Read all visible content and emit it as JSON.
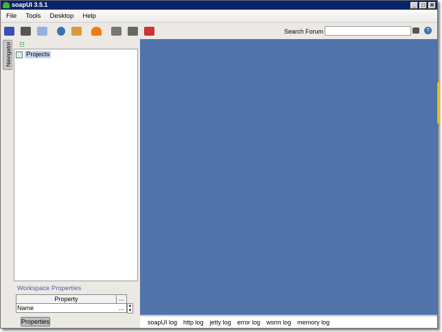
{
  "window": {
    "title": "soapUI 3.5.1",
    "controls": [
      "_",
      "□",
      "✕"
    ]
  },
  "menu": [
    "File",
    "Tools",
    "Desktop",
    "Help"
  ],
  "toolbar": {
    "search_label": "Search Forum",
    "search_value": "",
    "help": "?"
  },
  "navigator": {
    "tab_label": "Navigator",
    "root": "Projects"
  },
  "workspace_properties": {
    "title": "Workspace Properties",
    "header": "Property",
    "header_more": "...",
    "rows": [
      {
        "name": "Name",
        "more": "..."
      }
    ],
    "button": "Properties"
  },
  "log_tabs": [
    "soapUI log",
    "http log",
    "jetty log",
    "error log",
    "wsrm log",
    "memory log"
  ],
  "colors": {
    "title_bar": "#0a246a",
    "desktop": "#4f73aa"
  }
}
